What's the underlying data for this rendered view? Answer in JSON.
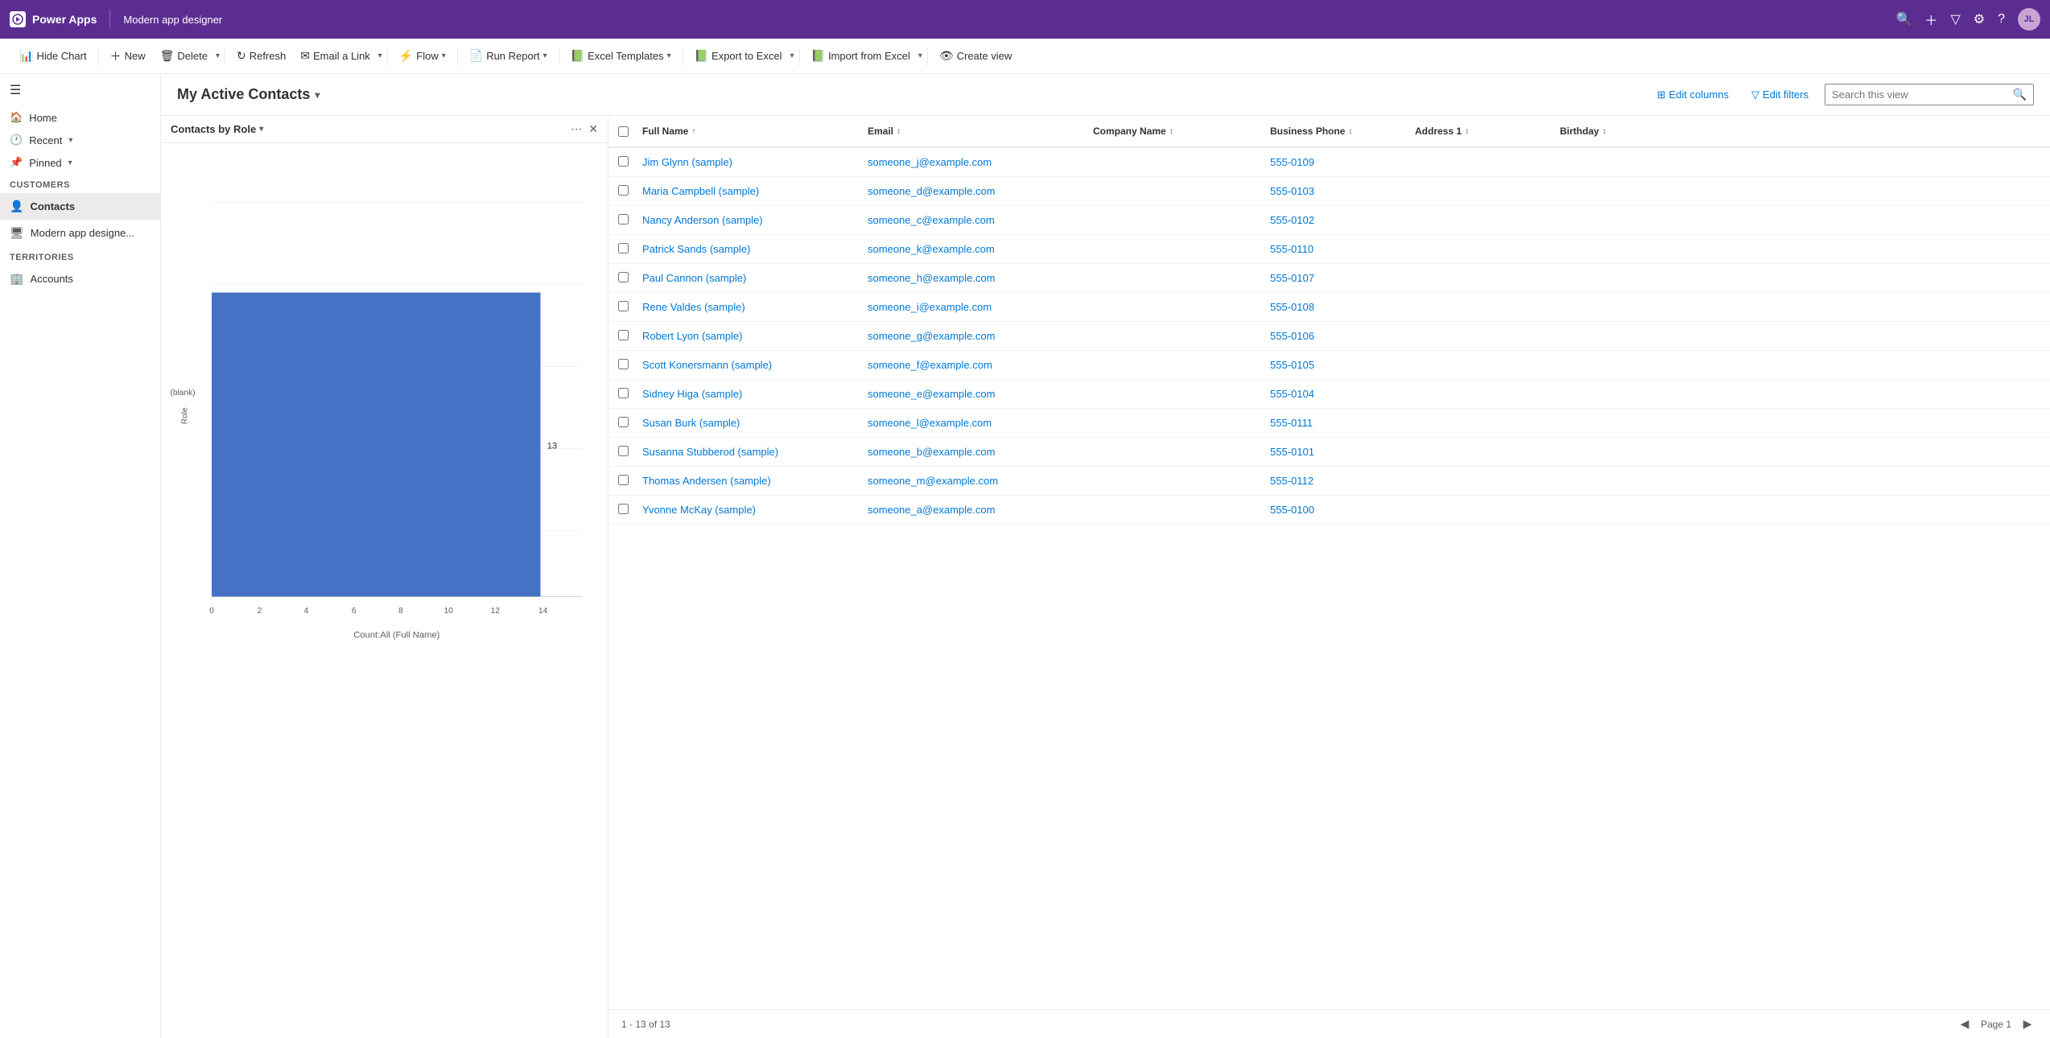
{
  "topbar": {
    "app_name": "Power Apps",
    "page_title": "Modern app designer",
    "avatar_initials": "JL"
  },
  "commandbar": {
    "hide_chart": "Hide Chart",
    "new": "New",
    "delete": "Delete",
    "refresh": "Refresh",
    "email_a_link": "Email a Link",
    "flow": "Flow",
    "run_report": "Run Report",
    "excel_templates": "Excel Templates",
    "export_to_excel": "Export to Excel",
    "import_from_excel": "Import from Excel",
    "create_view": "Create view"
  },
  "sidebar": {
    "sections": [
      {
        "label": "Customers",
        "items": [
          {
            "id": "contacts",
            "label": "Contacts",
            "active": true
          },
          {
            "id": "modern-app-designer",
            "label": "Modern app designe..."
          }
        ]
      },
      {
        "label": "Territories",
        "items": [
          {
            "id": "accounts",
            "label": "Accounts"
          }
        ]
      }
    ],
    "nav": {
      "home": "Home",
      "recent": "Recent",
      "pinned": "Pinned"
    }
  },
  "view": {
    "title": "My Active Contacts",
    "actions": {
      "edit_columns": "Edit columns",
      "edit_filters": "Edit filters",
      "search_placeholder": "Search this view"
    }
  },
  "chart": {
    "title": "Contacts by Role",
    "blank_label": "(blank)",
    "y_axis_label": "Role",
    "x_axis_title": "Count:All (Full Name)",
    "bar_value": 13,
    "x_labels": [
      "0",
      "2",
      "4",
      "6",
      "8",
      "10",
      "12",
      "14"
    ]
  },
  "grid": {
    "columns": [
      {
        "id": "fullname",
        "label": "Full Name",
        "sortable": true,
        "sort": "asc"
      },
      {
        "id": "email",
        "label": "Email",
        "sortable": true
      },
      {
        "id": "company",
        "label": "Company Name",
        "sortable": true
      },
      {
        "id": "phone",
        "label": "Business Phone",
        "sortable": true
      },
      {
        "id": "address",
        "label": "Address 1",
        "sortable": true
      },
      {
        "id": "birthday",
        "label": "Birthday",
        "sortable": true
      }
    ],
    "rows": [
      {
        "fullname": "Jim Glynn (sample)",
        "email": "someone_j@example.com",
        "company": "",
        "phone": "555-0109",
        "address": "",
        "birthday": ""
      },
      {
        "fullname": "Maria Campbell (sample)",
        "email": "someone_d@example.com",
        "company": "",
        "phone": "555-0103",
        "address": "",
        "birthday": ""
      },
      {
        "fullname": "Nancy Anderson (sample)",
        "email": "someone_c@example.com",
        "company": "",
        "phone": "555-0102",
        "address": "",
        "birthday": ""
      },
      {
        "fullname": "Patrick Sands (sample)",
        "email": "someone_k@example.com",
        "company": "",
        "phone": "555-0110",
        "address": "",
        "birthday": ""
      },
      {
        "fullname": "Paul Cannon (sample)",
        "email": "someone_h@example.com",
        "company": "",
        "phone": "555-0107",
        "address": "",
        "birthday": ""
      },
      {
        "fullname": "Rene Valdes (sample)",
        "email": "someone_i@example.com",
        "company": "",
        "phone": "555-0108",
        "address": "",
        "birthday": ""
      },
      {
        "fullname": "Robert Lyon (sample)",
        "email": "someone_g@example.com",
        "company": "",
        "phone": "555-0106",
        "address": "",
        "birthday": ""
      },
      {
        "fullname": "Scott Konersmann (sample)",
        "email": "someone_f@example.com",
        "company": "",
        "phone": "555-0105",
        "address": "",
        "birthday": ""
      },
      {
        "fullname": "Sidney Higa (sample)",
        "email": "someone_e@example.com",
        "company": "",
        "phone": "555-0104",
        "address": "",
        "birthday": ""
      },
      {
        "fullname": "Susan Burk (sample)",
        "email": "someone_l@example.com",
        "company": "",
        "phone": "555-0111",
        "address": "",
        "birthday": ""
      },
      {
        "fullname": "Susanna Stubberod (sample)",
        "email": "someone_b@example.com",
        "company": "",
        "phone": "555-0101",
        "address": "",
        "birthday": ""
      },
      {
        "fullname": "Thomas Andersen (sample)",
        "email": "someone_m@example.com",
        "company": "",
        "phone": "555-0112",
        "address": "",
        "birthday": ""
      },
      {
        "fullname": "Yvonne McKay (sample)",
        "email": "someone_a@example.com",
        "company": "",
        "phone": "555-0100",
        "address": "",
        "birthday": ""
      }
    ],
    "footer": {
      "count_text": "1 - 13 of 13",
      "page_label": "Page 1"
    }
  }
}
